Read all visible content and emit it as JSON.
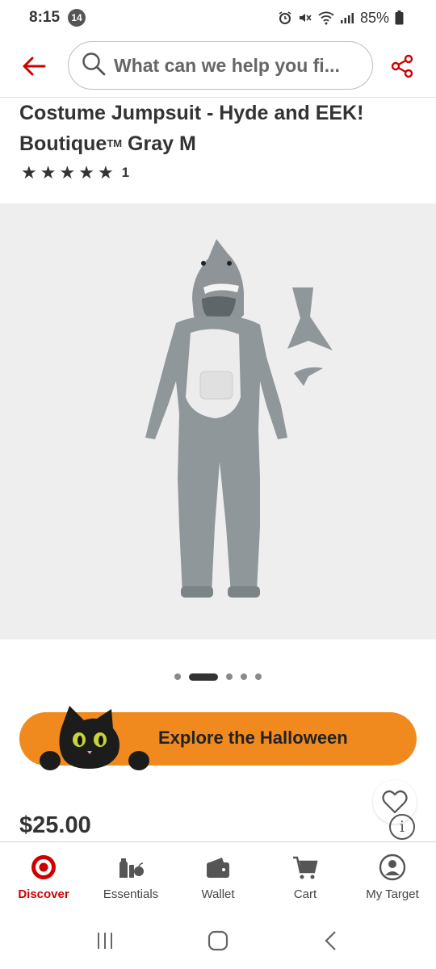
{
  "status_bar": {
    "time": "8:15",
    "notification_count": "14",
    "battery": "85%"
  },
  "search": {
    "text": "What can we help you fi..."
  },
  "product": {
    "title_line1": "Costume Jumpsuit - Hyde and EEK!",
    "title_line2_prefix": "Boutique",
    "title_trademark": "TM",
    "title_line2_suffix": " Gray M",
    "rating_stars": 5,
    "rating_count": "1",
    "price": "$25.00"
  },
  "carousel": {
    "total": 5,
    "active_index": 1
  },
  "promo": {
    "label": "Explore the Halloween"
  },
  "tabs": [
    {
      "label": "Discover",
      "icon": "bullseye-icon",
      "active": true
    },
    {
      "label": "Essentials",
      "icon": "essentials-icon",
      "active": false
    },
    {
      "label": "Wallet",
      "icon": "wallet-icon",
      "active": false
    },
    {
      "label": "Cart",
      "icon": "cart-icon",
      "active": false
    },
    {
      "label": "My Target",
      "icon": "user-icon",
      "active": false
    }
  ],
  "colors": {
    "brand_red": "#cc0000",
    "promo_orange": "#f08a1f",
    "image_background": "#eeeeee"
  }
}
